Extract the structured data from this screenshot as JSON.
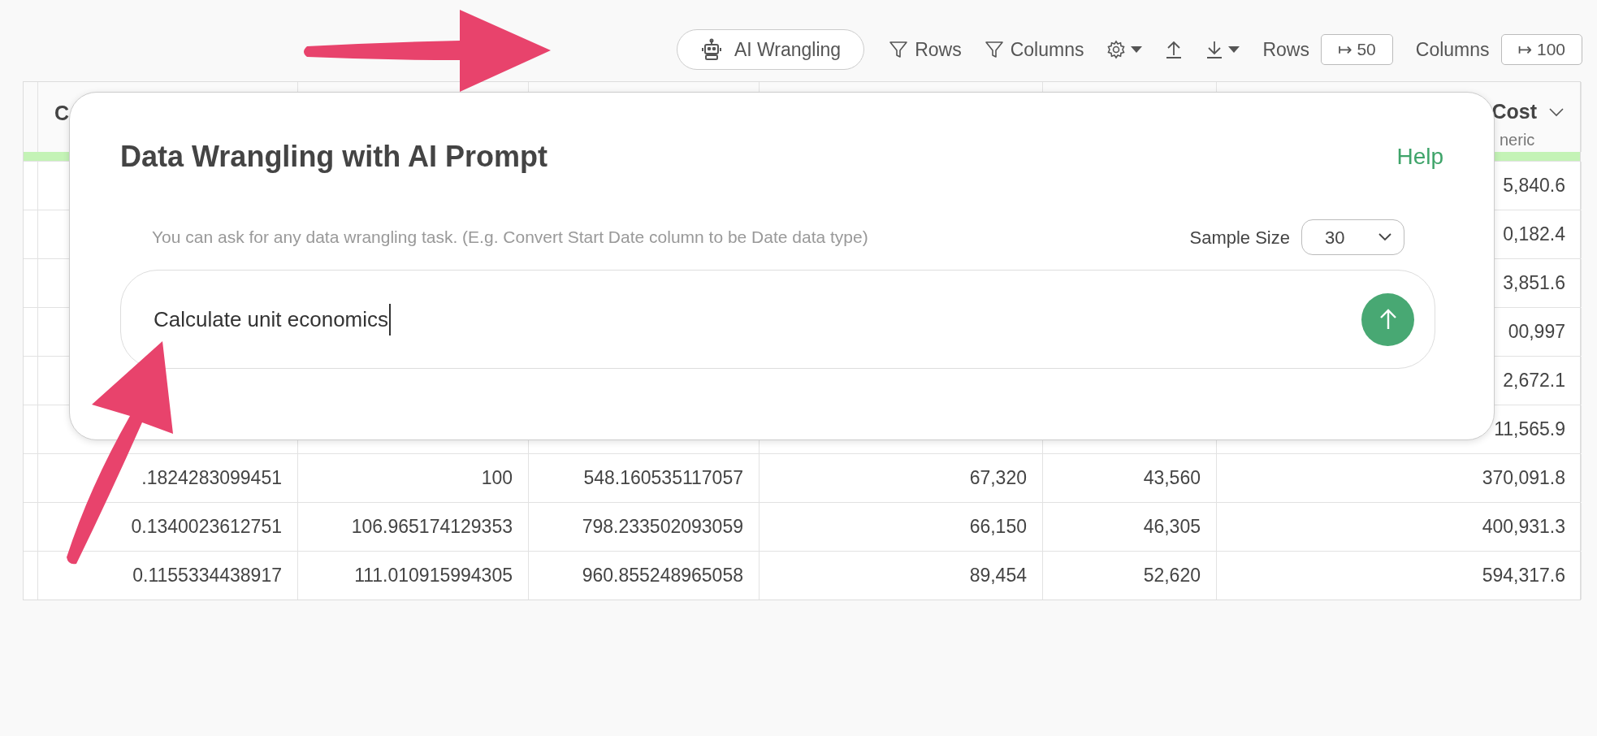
{
  "toolbar": {
    "ai_button": "AI Wrangling",
    "filters": [
      {
        "label": "Rows"
      },
      {
        "label": "Columns"
      }
    ],
    "limits": [
      {
        "label": "Rows",
        "value": "↦ 50"
      },
      {
        "label": "Columns",
        "value": "↦ 100"
      }
    ]
  },
  "table": {
    "first_header": "C",
    "last_header": {
      "name": "Cost",
      "type": "neric"
    },
    "rows": [
      [
        null,
        null,
        null,
        null,
        null,
        "5,840.6"
      ],
      [
        null,
        null,
        null,
        null,
        null,
        "0,182.4"
      ],
      [
        null,
        null,
        null,
        null,
        null,
        "3,851.6"
      ],
      [
        null,
        null,
        null,
        null,
        null,
        "00,997"
      ],
      [
        null,
        null,
        null,
        null,
        null,
        "2,672.1"
      ],
      [
        null,
        null,
        null,
        null,
        null,
        "11,565.9"
      ],
      [
        ".1824283099451",
        "100",
        "548.160535117057",
        "67,320",
        "43,560",
        "370,091.8"
      ],
      [
        "0.1340023612751",
        "106.965174129353",
        "798.233502093059",
        "66,150",
        "46,305",
        "400,931.3"
      ],
      [
        "0.1155334438917",
        "111.010915994305",
        "960.855248965058",
        "89,454",
        "52,620",
        "594,317.6"
      ]
    ]
  },
  "dialog": {
    "title": "Data Wrangling with AI Prompt",
    "help": "Help",
    "hint": "You can ask for any data wrangling task. (E.g. Convert Start Date column to be Date data type)",
    "sample_size": {
      "label": "Sample Size",
      "value": "30"
    },
    "prompt": "Calculate unit economics"
  }
}
